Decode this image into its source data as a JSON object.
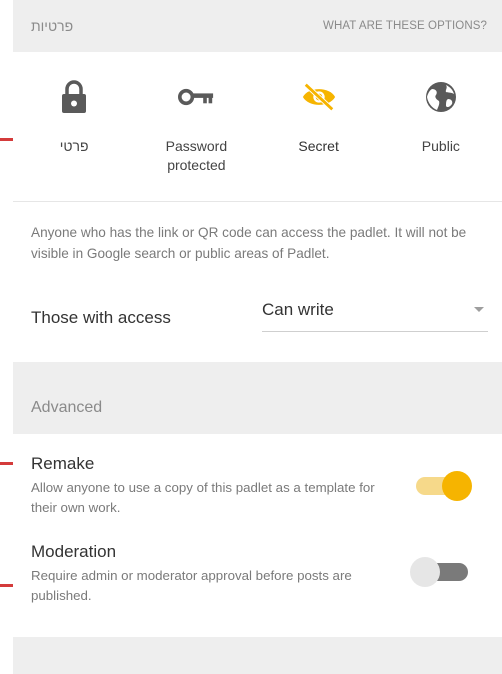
{
  "header": {
    "title": "פרטיות",
    "help_link": "WHAT ARE THESE OPTIONS?"
  },
  "privacy_options": [
    {
      "label": "פרטי",
      "icon": "lock-icon",
      "selected": false
    },
    {
      "label": "Password protected",
      "icon": "key-icon",
      "selected": false
    },
    {
      "label": "Secret",
      "icon": "eye-off-icon",
      "selected": true
    },
    {
      "label": "Public",
      "icon": "globe-icon",
      "selected": false
    }
  ],
  "description": "Anyone who has the link or QR code can access the padlet. It will not be visible in Google search or public areas of Padlet.",
  "access": {
    "label": "Those with access",
    "value": "Can write"
  },
  "advanced": {
    "title": "Advanced",
    "settings": [
      {
        "title": "Remake",
        "description": "Allow anyone to use a copy of this padlet as a template for their own work.",
        "enabled": true
      },
      {
        "title": "Moderation",
        "description": "Require admin or moderator approval before posts are published.",
        "enabled": false
      }
    ]
  },
  "colors": {
    "accent": "#f6b400",
    "accent_light": "#f6d98a",
    "icon_dark": "#5a5a5a",
    "section_bg": "#eeeeee",
    "annotation": "#d43b3b"
  }
}
